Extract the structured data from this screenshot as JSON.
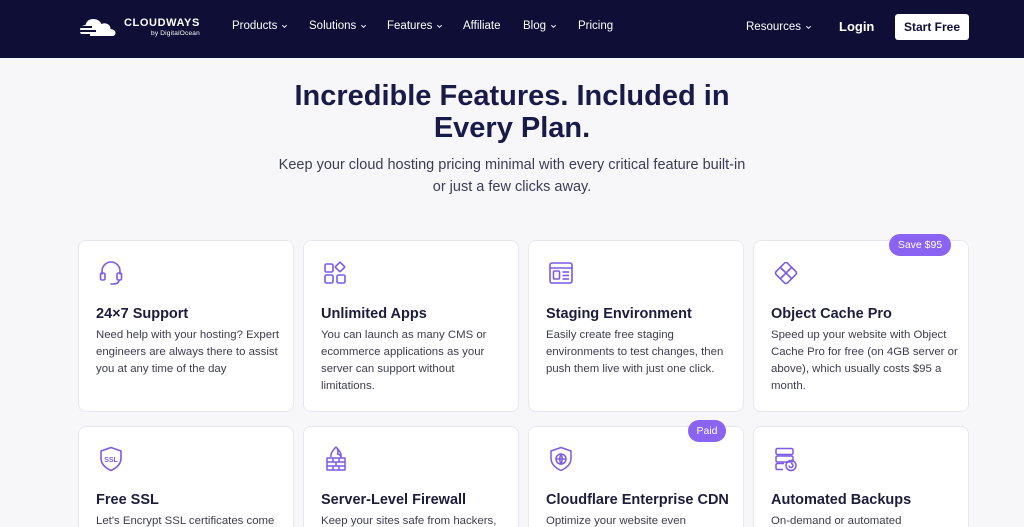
{
  "brand": {
    "name": "CLOUDWAYS",
    "sub": "by DigitalOcean"
  },
  "nav": {
    "items": [
      {
        "label": "Products",
        "dropdown": true
      },
      {
        "label": "Solutions",
        "dropdown": true
      },
      {
        "label": "Features",
        "dropdown": true
      },
      {
        "label": "Affiliate",
        "dropdown": false
      },
      {
        "label": "Blog",
        "dropdown": true
      },
      {
        "label": "Pricing",
        "dropdown": false
      }
    ],
    "resources": "Resources",
    "login": "Login",
    "start": "Start Free"
  },
  "hero": {
    "title_line1": "Incredible Features. Included in",
    "title_line2": "Every Plan.",
    "subtitle_line1": "Keep your cloud hosting pricing minimal with every critical feature built-in",
    "subtitle_line2": "or just a few clicks away."
  },
  "cards": [
    {
      "icon": "headset-icon",
      "title": "24×7 Support",
      "desc": "Need help with your hosting? Expert engineers are always there to assist you at any time of the day"
    },
    {
      "icon": "apps-grid-icon",
      "title": "Unlimited Apps",
      "desc": "You can launch as many CMS or ecommerce applications as your server can support without limitations."
    },
    {
      "icon": "staging-window-icon",
      "title": "Staging Environment",
      "desc": "Easily create free staging environments to test changes, then push them live with just one click."
    },
    {
      "icon": "object-cache-icon",
      "title": "Object Cache Pro",
      "desc": "Speed up your website with Object Cache Pro for free (on 4GB server or above), which usually costs $95 a month.",
      "badge": "Save $95"
    },
    {
      "icon": "ssl-shield-icon",
      "title": "Free SSL",
      "desc": "Let's Encrypt SSL certificates come"
    },
    {
      "icon": "firewall-icon",
      "title": "Server-Level Firewall",
      "desc": "Keep your sites safe from hackers,"
    },
    {
      "icon": "cloudflare-shield-icon",
      "title": "Cloudflare Enterprise CDN",
      "desc": "Optimize your website even",
      "badge": "Paid"
    },
    {
      "icon": "backup-server-icon",
      "title": "Automated Backups",
      "desc": "On-demand or automated"
    }
  ],
  "colors": {
    "nav_bg": "#0e0e36",
    "accent": "#8a63f3",
    "icon": "#7b5ae6",
    "title": "#1a1a4a"
  }
}
